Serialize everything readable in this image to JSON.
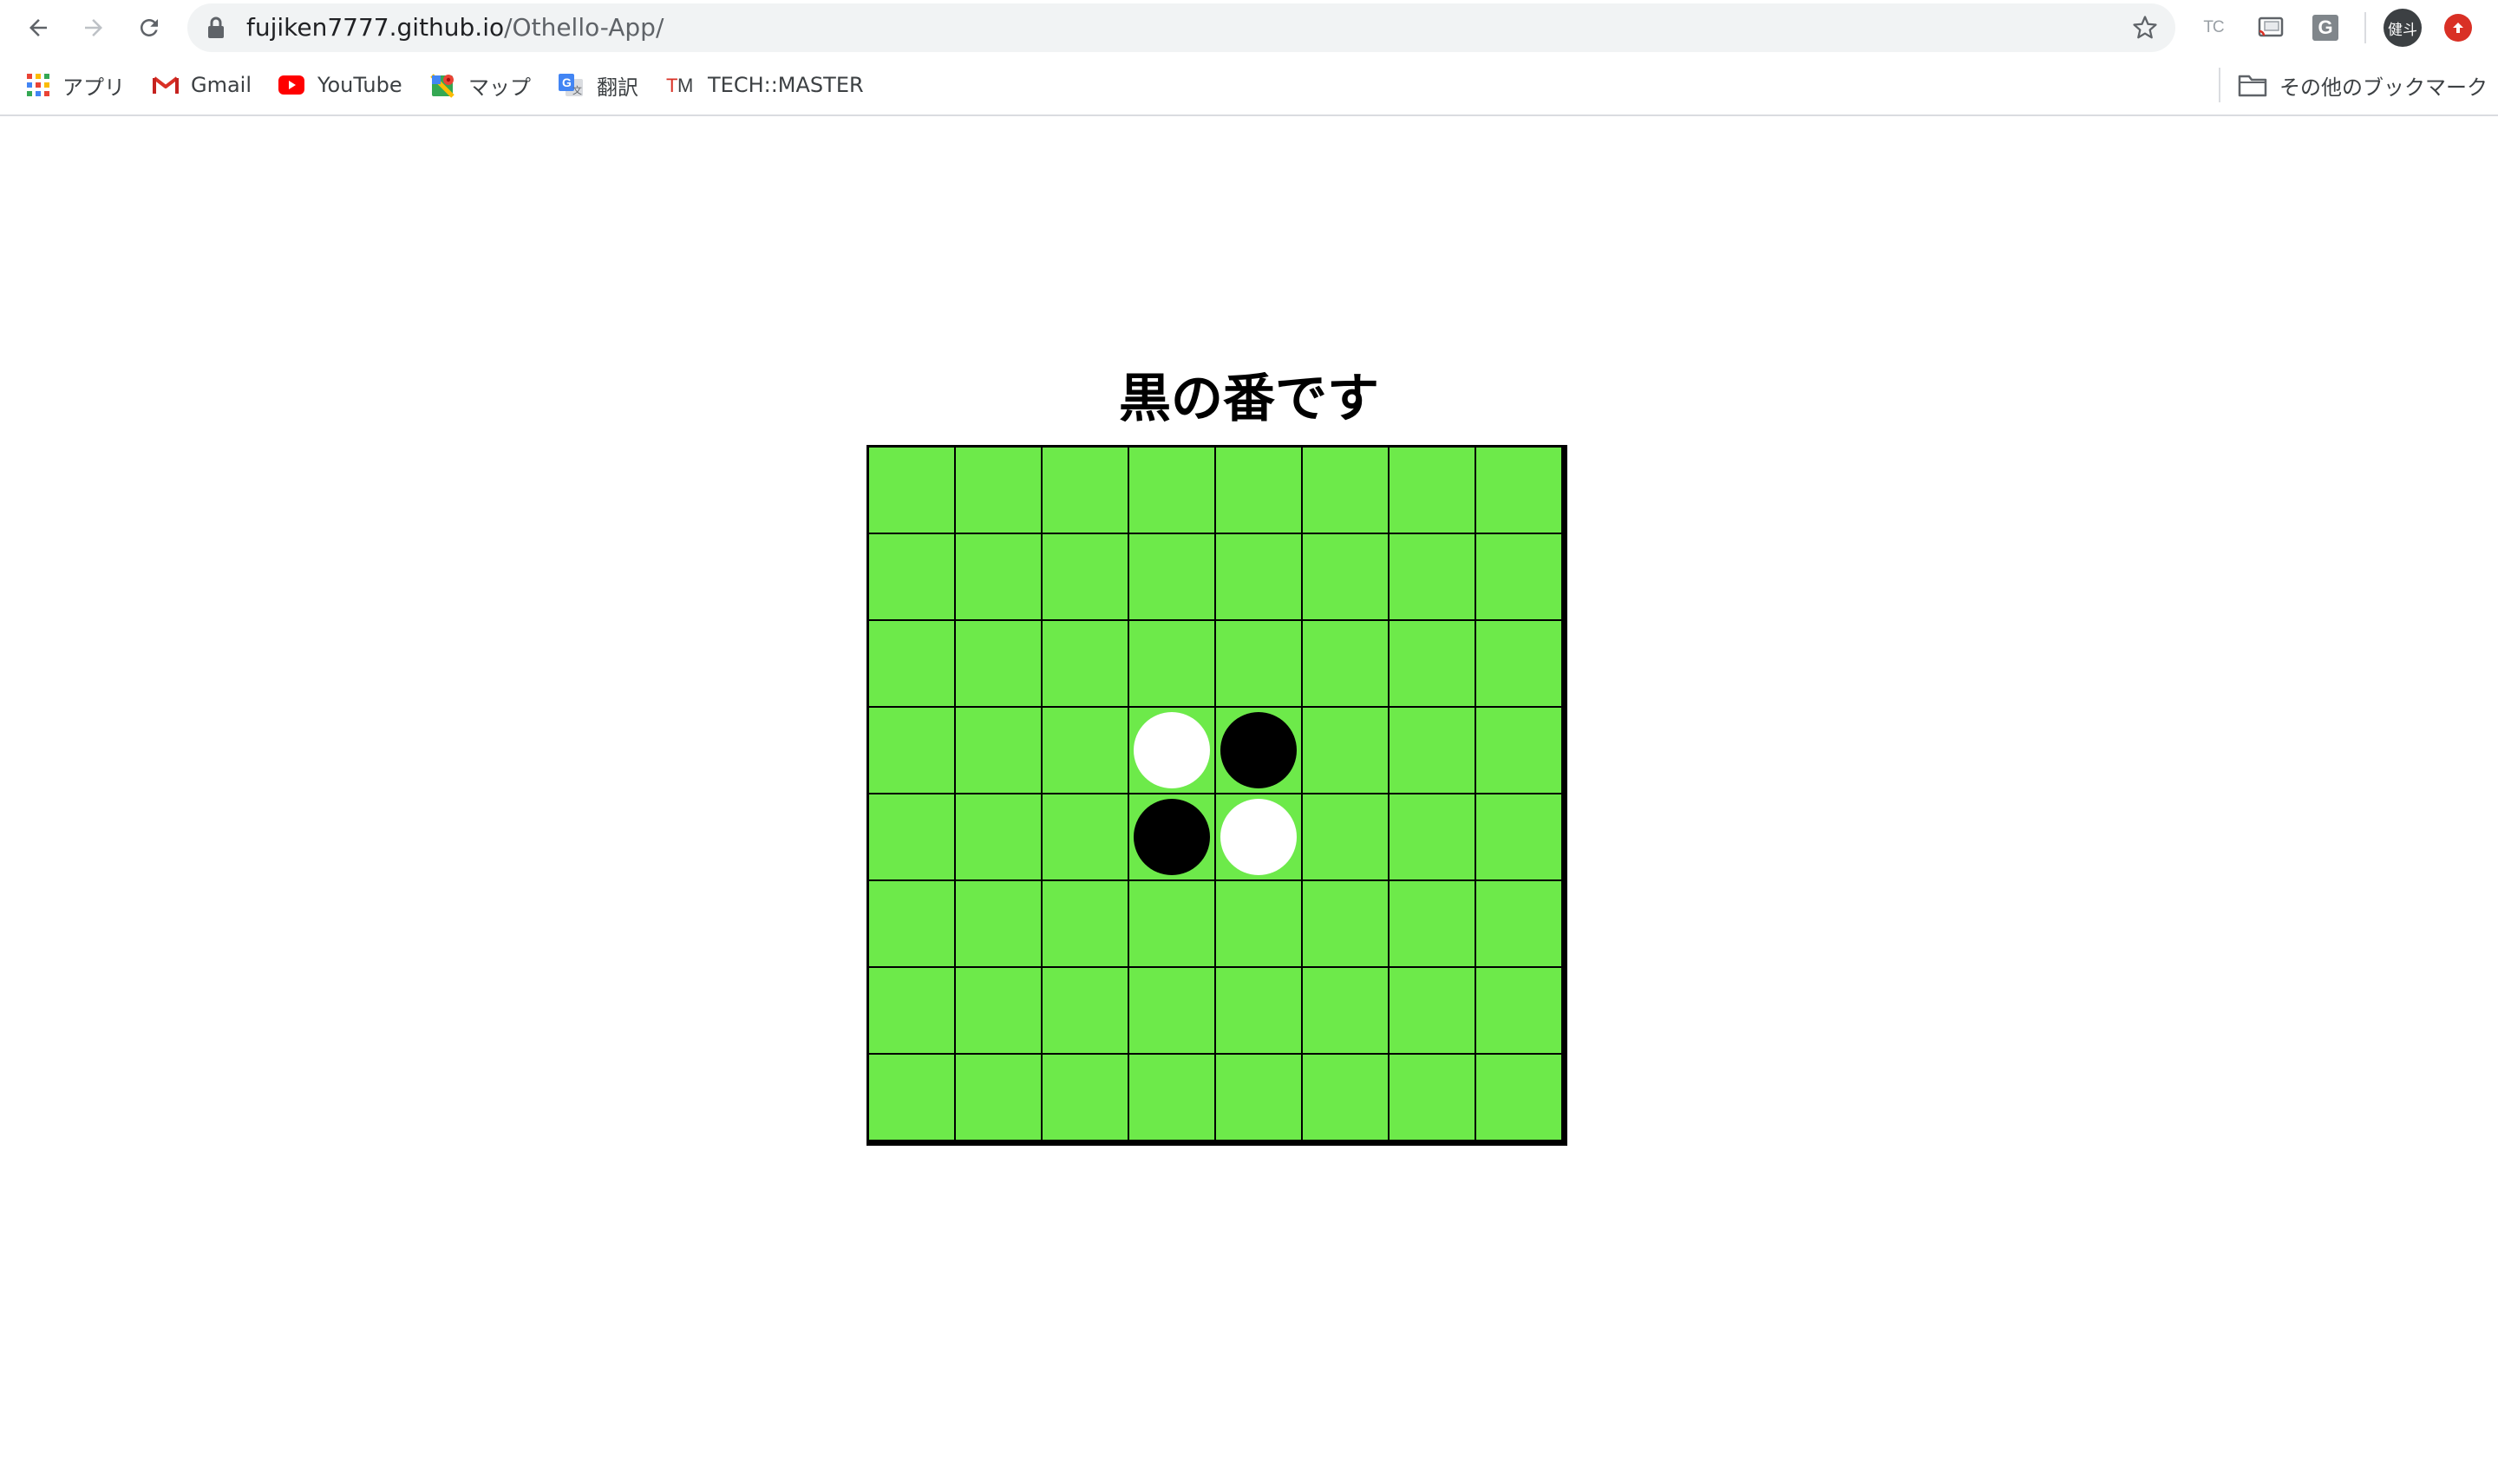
{
  "browser": {
    "url_host": "fujiken7777.github.io",
    "url_path": "/Othello-App/",
    "extensions": [
      "TC",
      "cast-icon",
      "G"
    ],
    "profile_initials": "健斗"
  },
  "bookmarks": {
    "items": [
      {
        "label": "アプリ",
        "icon": "apps-grid-icon"
      },
      {
        "label": "Gmail",
        "icon": "gmail-icon"
      },
      {
        "label": "YouTube",
        "icon": "youtube-icon"
      },
      {
        "label": "マップ",
        "icon": "maps-icon"
      },
      {
        "label": "翻訳",
        "icon": "translate-icon"
      },
      {
        "label": "TECH::MASTER",
        "icon": "techmaster-icon"
      }
    ],
    "other_label": "その他のブックマーク"
  },
  "game": {
    "turn_message": "黒の番です",
    "board_color": "#6dea4a",
    "board": [
      [
        "",
        "",
        "",
        "",
        "",
        "",
        "",
        ""
      ],
      [
        "",
        "",
        "",
        "",
        "",
        "",
        "",
        ""
      ],
      [
        "",
        "",
        "",
        "",
        "",
        "",
        "",
        ""
      ],
      [
        "",
        "",
        "",
        "white",
        "black",
        "",
        "",
        ""
      ],
      [
        "",
        "",
        "",
        "black",
        "white",
        "",
        "",
        ""
      ],
      [
        "",
        "",
        "",
        "",
        "",
        "",
        "",
        ""
      ],
      [
        "",
        "",
        "",
        "",
        "",
        "",
        "",
        ""
      ],
      [
        "",
        "",
        "",
        "",
        "",
        "",
        "",
        ""
      ]
    ]
  }
}
